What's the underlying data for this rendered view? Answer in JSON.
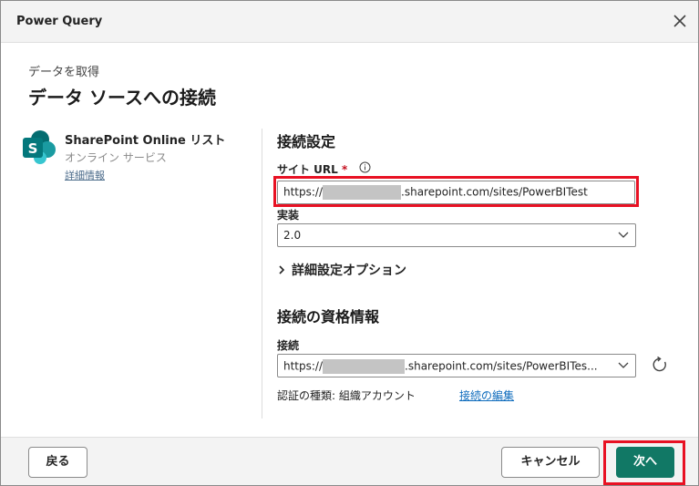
{
  "window": {
    "title": "Power Query"
  },
  "header": {
    "breadcrumb": "データを取得",
    "title": "データ ソースへの接続"
  },
  "connector": {
    "name": "SharePoint Online リスト",
    "subtitle": "オンライン サービス",
    "details_link": "詳細情報",
    "logo_letter": "S"
  },
  "settings": {
    "section_title": "接続設定",
    "site_url_label": "サイト URL",
    "required_marker": "*",
    "site_url_prefix": "https://",
    "site_url_suffix": ".sharepoint.com/sites/PowerBITest",
    "implementation_label": "実装",
    "implementation_value": "2.0",
    "advanced_options": "詳細設定オプション"
  },
  "credentials": {
    "section_title": "接続の資格情報",
    "connection_label": "接続",
    "connection_prefix": "https://",
    "connection_suffix": ".sharepoint.com/sites/PowerBITes...",
    "auth_type": "認証の種類: 組織アカウント",
    "edit_link": "接続の編集"
  },
  "footer": {
    "back": "戻る",
    "cancel": "キャンセル",
    "next": "次へ"
  },
  "colors": {
    "primary": "#117865",
    "link": "#0f6cbd",
    "highlight": "#e81123"
  }
}
